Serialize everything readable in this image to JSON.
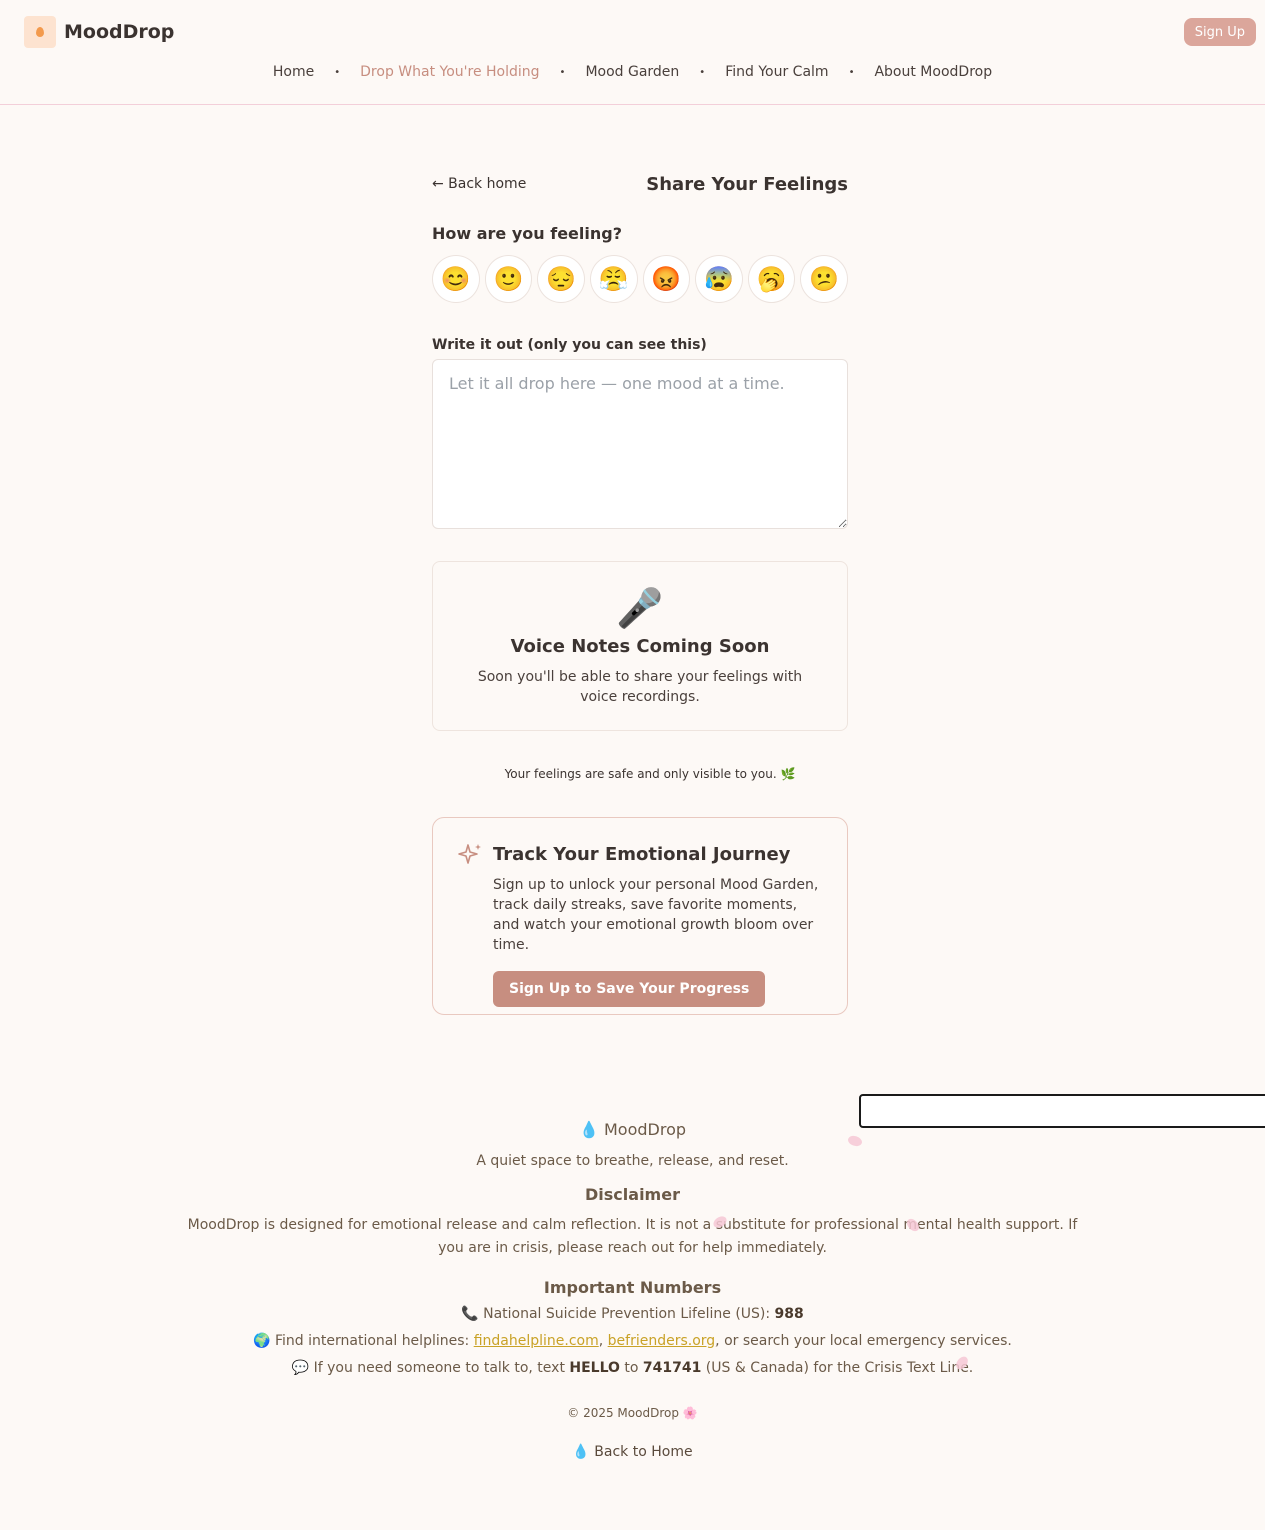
{
  "brand": {
    "name": "MoodDrop"
  },
  "header": {
    "signup_label": "Sign Up",
    "nav": [
      {
        "label": "Home",
        "active": false
      },
      {
        "label": "Drop What You're Holding",
        "active": true
      },
      {
        "label": "Mood Garden",
        "active": false
      },
      {
        "label": "Find Your Calm",
        "active": false
      },
      {
        "label": "About MoodDrop",
        "active": false
      }
    ],
    "nav_separator": "•"
  },
  "main": {
    "back_label": "← Back home",
    "title": "Share Your Feelings",
    "question": "How are you feeling?",
    "moods": [
      "😊",
      "🙂",
      "😔",
      "😤",
      "😡",
      "😰",
      "🥱",
      "😕"
    ],
    "write_label": "Write it out (only you can see this)",
    "write_placeholder": "Let it all drop here — one mood at a time.",
    "voice": {
      "icon": "🎤",
      "title": "Voice Notes Coming Soon",
      "text": "Soon you'll be able to share your feelings with voice recordings."
    },
    "safe_note": "Your feelings are safe and only visible to you. 🌿",
    "track": {
      "title": "Track Your Emotional Journey",
      "text": "Sign up to unlock your personal Mood Garden, track daily streaks, save favorite moments, and watch your emotional growth bloom over time.",
      "button_label": "Sign Up to Save Your Progress"
    }
  },
  "footer": {
    "brand": "💧 MoodDrop",
    "tagline": "A quiet space to breathe, release, and reset.",
    "disclaimer_heading": "Disclaimer",
    "disclaimer_text": "MoodDrop is designed for emotional release and calm reflection. It is not a substitute for professional mental health support. If you are in crisis, please reach out for help immediately.",
    "numbers_heading": "Important Numbers",
    "lifeline_prefix": "📞 National Suicide Prevention Lifeline (US): ",
    "lifeline_number": "988",
    "intl_prefix": "🌍 Find international helplines: ",
    "intl_link1": "findahelpline.com",
    "intl_sep": ", ",
    "intl_link2": "befrienders.org",
    "intl_suffix": ", or search your local emergency services.",
    "text_prefix": "💬 If you need someone to talk to, text ",
    "text_keyword": "HELLO",
    "text_mid": " to ",
    "text_number": "741741",
    "text_suffix": " (US & Canada) for the Crisis Text Line.",
    "copyright": "© 2025 MoodDrop 🌸",
    "back_label": "💧 Back to Home"
  },
  "colors": {
    "background": "#fdf9f6",
    "accent": "#c78e80",
    "signup_button": "#dba69b",
    "nav_active": "#c78e80",
    "footer_text": "#6b5a48",
    "link": "#c9a227",
    "header_border": "#f3cfd9"
  }
}
